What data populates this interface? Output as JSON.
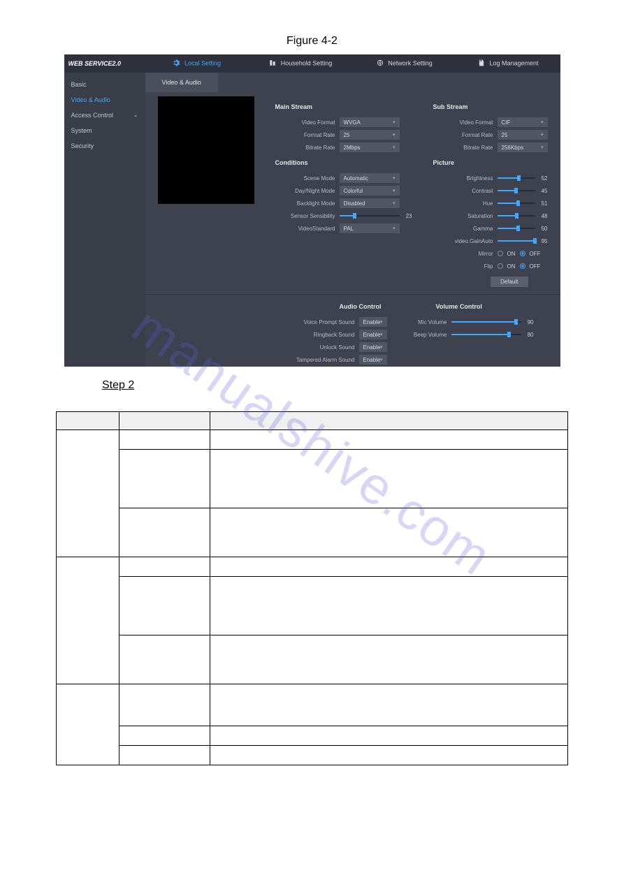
{
  "figure_caption": "Figure 4-2",
  "watermark": "manualshive.com",
  "step_label": "Step 2",
  "header": {
    "logo": "WEB SERVICE2.0",
    "nav": [
      {
        "label": "Local Setting",
        "active": true
      },
      {
        "label": "Household Setting",
        "active": false
      },
      {
        "label": "Network Setting",
        "active": false
      },
      {
        "label": "Log Management",
        "active": false
      }
    ]
  },
  "sidebar": {
    "items": [
      {
        "label": "Basic",
        "selected": false,
        "expandable": false
      },
      {
        "label": "Video & Audio",
        "selected": true,
        "expandable": false
      },
      {
        "label": "Access Control",
        "selected": false,
        "expandable": true
      },
      {
        "label": "System",
        "selected": false,
        "expandable": false
      },
      {
        "label": "Security",
        "selected": false,
        "expandable": false
      }
    ]
  },
  "tab": {
    "label": "Video & Audio"
  },
  "main_stream": {
    "title": "Main Stream",
    "video_format": {
      "label": "Video Format",
      "value": "WVGA"
    },
    "format_rate": {
      "label": "Format Rate",
      "value": "25"
    },
    "bitrate": {
      "label": "Bitrate Rate",
      "value": "2Mbps"
    }
  },
  "sub_stream": {
    "title": "Sub Stream",
    "video_format": {
      "label": "Video Format",
      "value": "CIF"
    },
    "format_rate": {
      "label": "Format Rate",
      "value": "25"
    },
    "bitrate": {
      "label": "Bitrate Rate",
      "value": "256Kbps"
    }
  },
  "conditions": {
    "title": "Conditions",
    "scene_mode": {
      "label": "Scene Mode",
      "value": "Automatic"
    },
    "day_night_mode": {
      "label": "Day/Night Mode",
      "value": "Colorful"
    },
    "backlight_mode": {
      "label": "Backlight Mode",
      "value": "Disabled"
    },
    "sensor_sens": {
      "label": "Sensor Sensibility",
      "value": 23
    },
    "video_standard": {
      "label": "VideoStandard",
      "value": "PAL"
    }
  },
  "picture": {
    "title": "Picture",
    "brightness": {
      "label": "Brightness",
      "value": 52
    },
    "contrast": {
      "label": "Contrast",
      "value": 45
    },
    "hue": {
      "label": "Hue",
      "value": 51
    },
    "saturation": {
      "label": "Saturation",
      "value": 48
    },
    "gamma": {
      "label": "Gamma",
      "value": 50
    },
    "gain_auto": {
      "label": "video.GainAuto",
      "value": 95
    },
    "mirror": {
      "label": "Mirror",
      "on_label": "ON",
      "off_label": "OFF",
      "selected": "OFF"
    },
    "flip": {
      "label": "Flip",
      "on_label": "ON",
      "off_label": "OFF",
      "selected": "OFF"
    },
    "default_btn": "Default"
  },
  "audio_control": {
    "title": "Audio Control",
    "voice_prompt": {
      "label": "Voice Prompt Sound",
      "value": "Enable"
    },
    "ringback": {
      "label": "Ringback Sound",
      "value": "Enable"
    },
    "unlock": {
      "label": "Unlock Sound",
      "value": "Enable"
    },
    "tampered_alarm": {
      "label": "Tampered Alarm Sound",
      "value": "Enable"
    }
  },
  "volume_control": {
    "title": "Volume Control",
    "mic_volume": {
      "label": "Mic Volume",
      "value": 90
    },
    "beep_volume": {
      "label": "Beep Volume",
      "value": 80
    }
  },
  "table": {
    "headers": [
      "",
      ""
    ],
    "rows": [
      {
        "cls": "h-small",
        "group_rowspan": 3,
        "group": "",
        "c1": "",
        "c2": ""
      },
      {
        "cls": "h-med",
        "c1": "",
        "c2": ""
      },
      {
        "cls": "h-med2",
        "c1": "",
        "c2": ""
      },
      {
        "cls": "h-small",
        "group_rowspan": 3,
        "group": "",
        "c1": "",
        "c2": ""
      },
      {
        "cls": "h-med",
        "c1": "",
        "c2": ""
      },
      {
        "cls": "h-med2",
        "c1": "",
        "c2": ""
      },
      {
        "cls": "h-big",
        "group_rowspan": 3,
        "group": "",
        "c1": "",
        "c2": ""
      },
      {
        "cls": "h-small",
        "c1": "",
        "c2": ""
      },
      {
        "cls": "h-small",
        "c1": "",
        "c2": ""
      }
    ]
  }
}
